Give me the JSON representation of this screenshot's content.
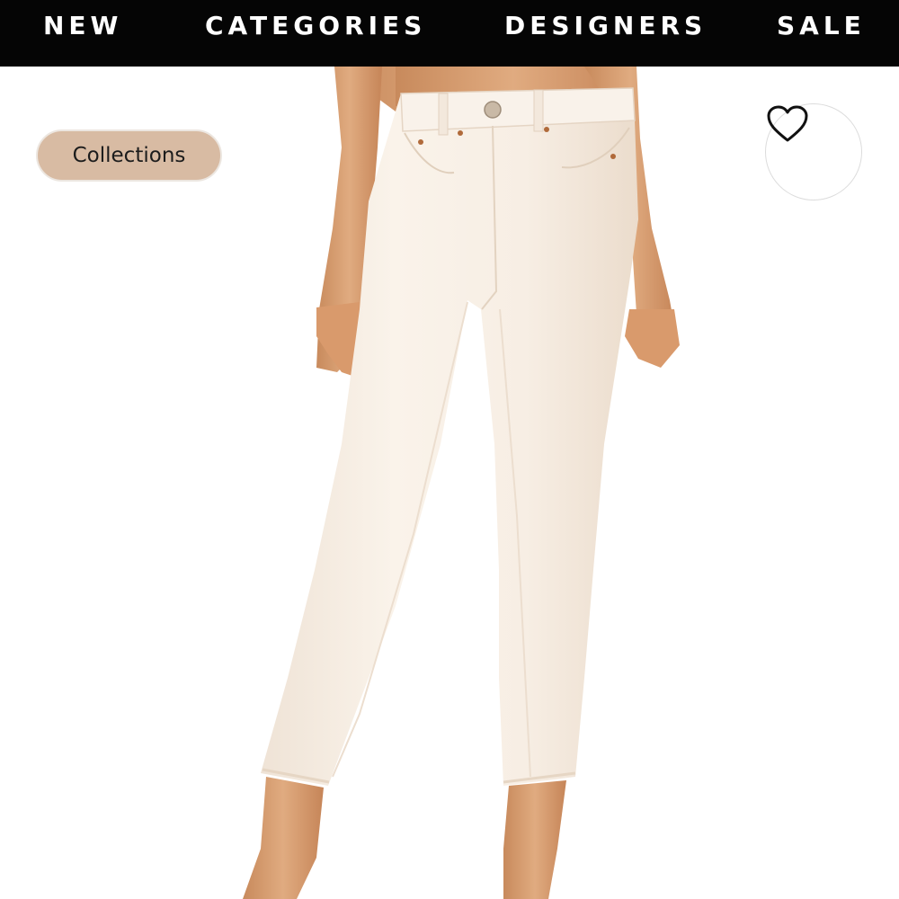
{
  "nav": {
    "items": [
      {
        "label": "NEW"
      },
      {
        "label": "CATEGORIES"
      },
      {
        "label": "DESIGNERS"
      },
      {
        "label": "SALE"
      }
    ]
  },
  "product": {
    "image_icon": "product-photo-cream-jeans"
  },
  "chip": {
    "label": "Collections"
  },
  "favorite": {
    "icon": "heart-icon"
  },
  "colors": {
    "nav_bg": "#050505",
    "chip_bg": "#d8bba3",
    "denim": "#f7efe6",
    "skin": "#d9a072"
  }
}
